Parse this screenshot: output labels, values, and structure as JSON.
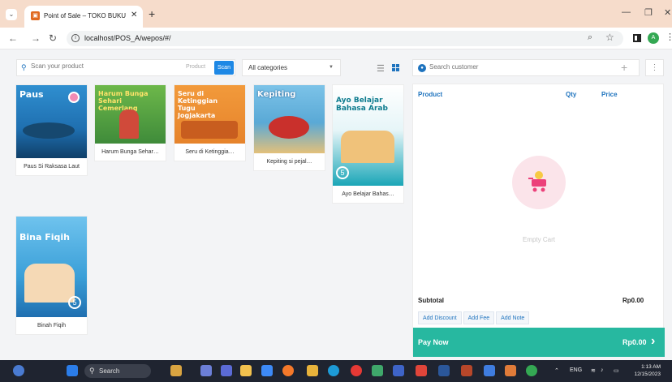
{
  "browser": {
    "tab_title": "Point of Sale – TOKO BUKU CE…",
    "url": "localhost/POS_A/wepos/#/",
    "profile_initial": "A"
  },
  "toolbar": {
    "search_placeholder": "Scan your product",
    "product_label": "Product",
    "scan_label": "Scan",
    "category_value": "All categories"
  },
  "products": [
    {
      "name": "Paus Si Raksasa Laut",
      "cover_title": "Paus",
      "cover_color": "#1f6fb0"
    },
    {
      "name": "Harum Bunga Sehar…",
      "cover_title": "Harum Bunga Sehari Cemerlang",
      "cover_color": "#3f8b3a"
    },
    {
      "name": "Seru di Ketinggia…",
      "cover_title": "Seru di Ketinggian Tugu Jogjakarta",
      "cover_color": "#e6832b"
    },
    {
      "name": "Kepiting si pejal…",
      "cover_title": "Kepiting",
      "cover_color": "#5aa9d6"
    },
    {
      "name": "Ayo Belajar Bahas…",
      "cover_title": "Ayo Belajar Bahasa Arab",
      "cover_color": "#1aa6b7"
    },
    {
      "name": "Binah Fiqih",
      "cover_title": "Bina Fiqih",
      "cover_color": "#3a9fd8"
    }
  ],
  "cart": {
    "customer_placeholder": "Search customer",
    "col_product": "Product",
    "col_qty": "Qty",
    "col_price": "Price",
    "empty_label": "Empty Cart",
    "subtotal_label": "Subtotal",
    "subtotal_value": "Rp0.00",
    "add_discount": "Add Discount",
    "add_fee": "Add Fee",
    "add_note": "Add Note",
    "pay_now": "Pay Now",
    "pay_amount": "Rp0.00"
  },
  "taskbar": {
    "search_label": "Search",
    "lang": "ENG",
    "time": "1:13 AM",
    "date": "12/15/2023"
  }
}
